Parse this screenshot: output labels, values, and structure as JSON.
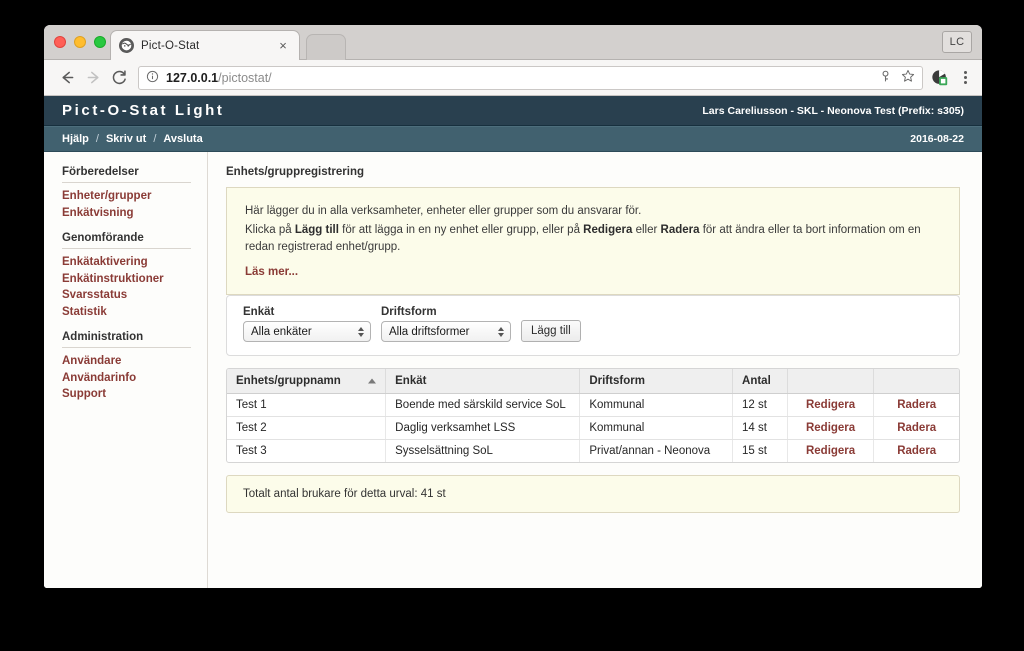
{
  "browser": {
    "tab": {
      "title": "Pict-O-Stat",
      "favicon": "globe-icon",
      "close": "×"
    },
    "profile_initials": "LC",
    "url": {
      "host": "127.0.0.1",
      "path": "/pictostat/"
    },
    "icons": {
      "back": "back-arrow-icon",
      "forward": "forward-arrow-icon",
      "reload": "reload-icon",
      "info": "page-info-icon",
      "key": "key-icon",
      "star": "bookmark-star-icon",
      "extension": "extension-icon",
      "menu": "overflow-menu-icon"
    }
  },
  "app": {
    "logo": "Pict-O-Stat Light",
    "user": "Lars Careliusson - SKL - Neonova Test (Prefix: s305)",
    "nav": [
      {
        "label": "Hjälp"
      },
      {
        "label": "Skriv ut"
      },
      {
        "label": "Avsluta"
      }
    ],
    "nav_separator": "/",
    "date": "2016-08-22"
  },
  "sidebar": {
    "groups": [
      {
        "heading": "Förberedelser",
        "links": [
          {
            "label": "Enheter/grupper"
          },
          {
            "label": "Enkätvisning"
          }
        ]
      },
      {
        "heading": "Genomförande",
        "links": [
          {
            "label": "Enkätaktivering"
          },
          {
            "label": "Enkätinstruktioner"
          },
          {
            "label": "Svarsstatus"
          },
          {
            "label": "Statistik"
          }
        ]
      },
      {
        "heading": "Administration",
        "links": [
          {
            "label": "Användare"
          },
          {
            "label": "Användarinfo"
          },
          {
            "label": "Support"
          }
        ]
      }
    ]
  },
  "main": {
    "page_title": "Enhets/gruppregistrering",
    "info": {
      "line1": "Här lägger du in alla verksamheter, enheter eller grupper som du ansvarar för.",
      "line2_a": "Klicka på ",
      "line2_b": "Lägg till",
      "line2_c": " för att lägga in en ny enhet eller grupp, eller på ",
      "line2_d": "Redigera",
      "line2_e": " eller ",
      "line2_f": "Radera",
      "line2_g": " för att ändra eller ta bort information om en redan registrerad enhet/grupp.",
      "read_more": "Läs mer..."
    },
    "filters": {
      "enkat": {
        "label": "Enkät",
        "value": "Alla enkäter"
      },
      "driftsform": {
        "label": "Driftsform",
        "value": "Alla driftsformer"
      },
      "add_button": "Lägg till"
    },
    "table": {
      "headers": [
        {
          "label": "Enhets/gruppnamn",
          "sorted": "asc"
        },
        {
          "label": "Enkät"
        },
        {
          "label": "Driftsform"
        },
        {
          "label": "Antal"
        },
        {
          "label": ""
        },
        {
          "label": ""
        }
      ],
      "rows": [
        {
          "name": "Test 1",
          "enkat": "Boende med särskild service SoL",
          "driftsform": "Kommunal",
          "antal": "12 st",
          "edit": "Redigera",
          "delete": "Radera"
        },
        {
          "name": "Test 2",
          "enkat": "Daglig verksamhet LSS",
          "driftsform": "Kommunal",
          "antal": "14 st",
          "edit": "Redigera",
          "delete": "Radera"
        },
        {
          "name": "Test 3",
          "enkat": "Sysselsättning SoL",
          "driftsform": "Privat/annan - Neonova",
          "antal": "15 st",
          "edit": "Redigera",
          "delete": "Radera"
        }
      ]
    },
    "total": "Totalt antal brukare för detta urval: 41 st"
  },
  "colors": {
    "header_bg": "#29404f",
    "nav_bg": "#41616f",
    "link_red": "#8a3b36",
    "info_bg": "#fcfcea",
    "info_border": "#ddd8c0"
  }
}
